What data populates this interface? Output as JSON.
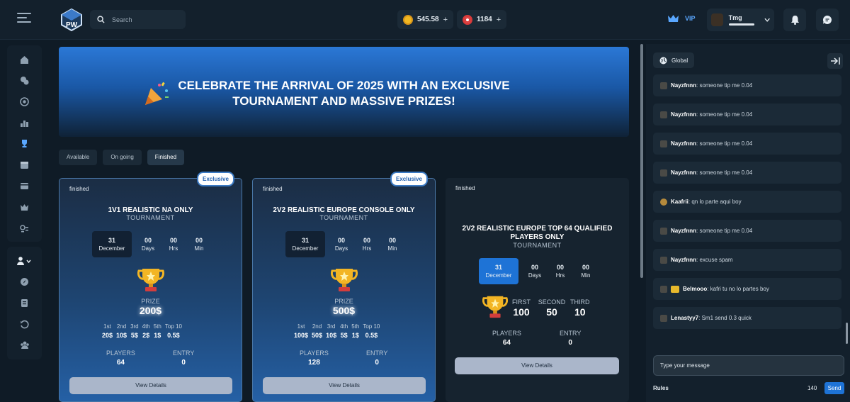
{
  "search": {
    "placeholder": "Search"
  },
  "wallet": {
    "coins": "545.58",
    "tickets": "1184",
    "plus": "+"
  },
  "vip": {
    "label": "VIP"
  },
  "user": {
    "name": "Tmg"
  },
  "banner": {
    "line1": "CELEBRATE THE ARRIVAL OF 2025 WITH AN EXCLUSIVE",
    "line2": "TOURNAMENT AND MASSIVE PRIZES!"
  },
  "tabs": [
    {
      "label": "Available"
    },
    {
      "label": "On going"
    },
    {
      "label": "Finished"
    }
  ],
  "sidebar": {
    "icons": [
      "home-icon",
      "chat-bubbles-icon",
      "target-icon",
      "leaderboard-icon",
      "trophy-icon",
      "calendar-icon",
      "wallet-icon",
      "crown-icon",
      "currency-settings-icon"
    ],
    "bottom": [
      "user-icon",
      "compass-icon",
      "document-icon",
      "history-icon",
      "group-icon"
    ]
  },
  "cards": [
    {
      "status": "finished",
      "badge": "Exclusive",
      "title": "1V1 REALISTIC NA ONLY",
      "subtitle": "TOURNAMENT",
      "day": "31",
      "month": "December",
      "days": "00",
      "hrs": "00",
      "min": "00",
      "labels": {
        "days": "Days",
        "hrs": "Hrs",
        "min": "Min"
      },
      "prize_label": "PRIZE",
      "prize": "200$",
      "ranks": [
        {
          "r": "1st",
          "v": "20$"
        },
        {
          "r": "2nd",
          "v": "10$"
        },
        {
          "r": "3rd",
          "v": "5$"
        },
        {
          "r": "4th",
          "v": "2$"
        },
        {
          "r": "5th",
          "v": "1$"
        },
        {
          "r": "Top 10",
          "v": "0.5$"
        }
      ],
      "players_label": "PLAYERS",
      "players": "64",
      "entry_label": "ENTRY",
      "entry": "0",
      "button": "View Details"
    },
    {
      "status": "finished",
      "badge": "Exclusive",
      "title": "2V2 REALISTIC EUROPE CONSOLE ONLY",
      "subtitle": "TOURNAMENT",
      "day": "31",
      "month": "December",
      "days": "00",
      "hrs": "00",
      "min": "00",
      "labels": {
        "days": "Days",
        "hrs": "Hrs",
        "min": "Min"
      },
      "prize_label": "PRIZE",
      "prize": "500$",
      "ranks": [
        {
          "r": "1st",
          "v": "100$"
        },
        {
          "r": "2nd",
          "v": "50$"
        },
        {
          "r": "3rd",
          "v": "10$"
        },
        {
          "r": "4th",
          "v": "5$"
        },
        {
          "r": "5th",
          "v": "1$"
        },
        {
          "r": "Top 10",
          "v": "0.5$"
        }
      ],
      "players_label": "PLAYERS",
      "players": "128",
      "entry_label": "ENTRY",
      "entry": "0",
      "button": "View Details"
    },
    {
      "status": "finished",
      "title1": "2V2 REALISTIC EUROPE TOP 64 QUALIFIED",
      "title2": "PLAYERS ONLY",
      "subtitle": "TOURNAMENT",
      "day": "31",
      "month": "December",
      "days": "00",
      "hrs": "00",
      "min": "00",
      "labels": {
        "days": "Days",
        "hrs": "Hrs",
        "min": "Min"
      },
      "first_label": "FIRST",
      "first": "100",
      "second_label": "SECOND",
      "second": "50",
      "third_label": "THIRD",
      "third": "10",
      "players_label": "PLAYERS",
      "players": "64",
      "entry_label": "ENTRY",
      "entry": "0",
      "button": "View Details"
    }
  ],
  "chat": {
    "channel": "Global",
    "messages": [
      {
        "user": "Nayzfnnn",
        "text": ": someone tip me 0.04"
      },
      {
        "user": "Nayzfnnn",
        "text": ": someone tip me 0.04"
      },
      {
        "user": "Nayzfnnn",
        "text": ": someone tip me 0.04"
      },
      {
        "user": "Nayzfnnn",
        "text": ": someone tip me 0.04"
      },
      {
        "user": "Kaafrii",
        "text": ": qn lo parte aqui boy"
      },
      {
        "user": "Nayzfnnn",
        "text": ": someone tip me 0.04"
      },
      {
        "user": "Nayzfnnn",
        "text": ": excuse spam"
      },
      {
        "user": "Belmooo",
        "text": ": kafri tu no lo partes boy"
      },
      {
        "user": "Lenastyy7",
        "text": ": Sm1 send 0.3 quick"
      }
    ],
    "input_placeholder": "Type your message",
    "rules": "Rules",
    "count": "140",
    "send": "Send"
  }
}
